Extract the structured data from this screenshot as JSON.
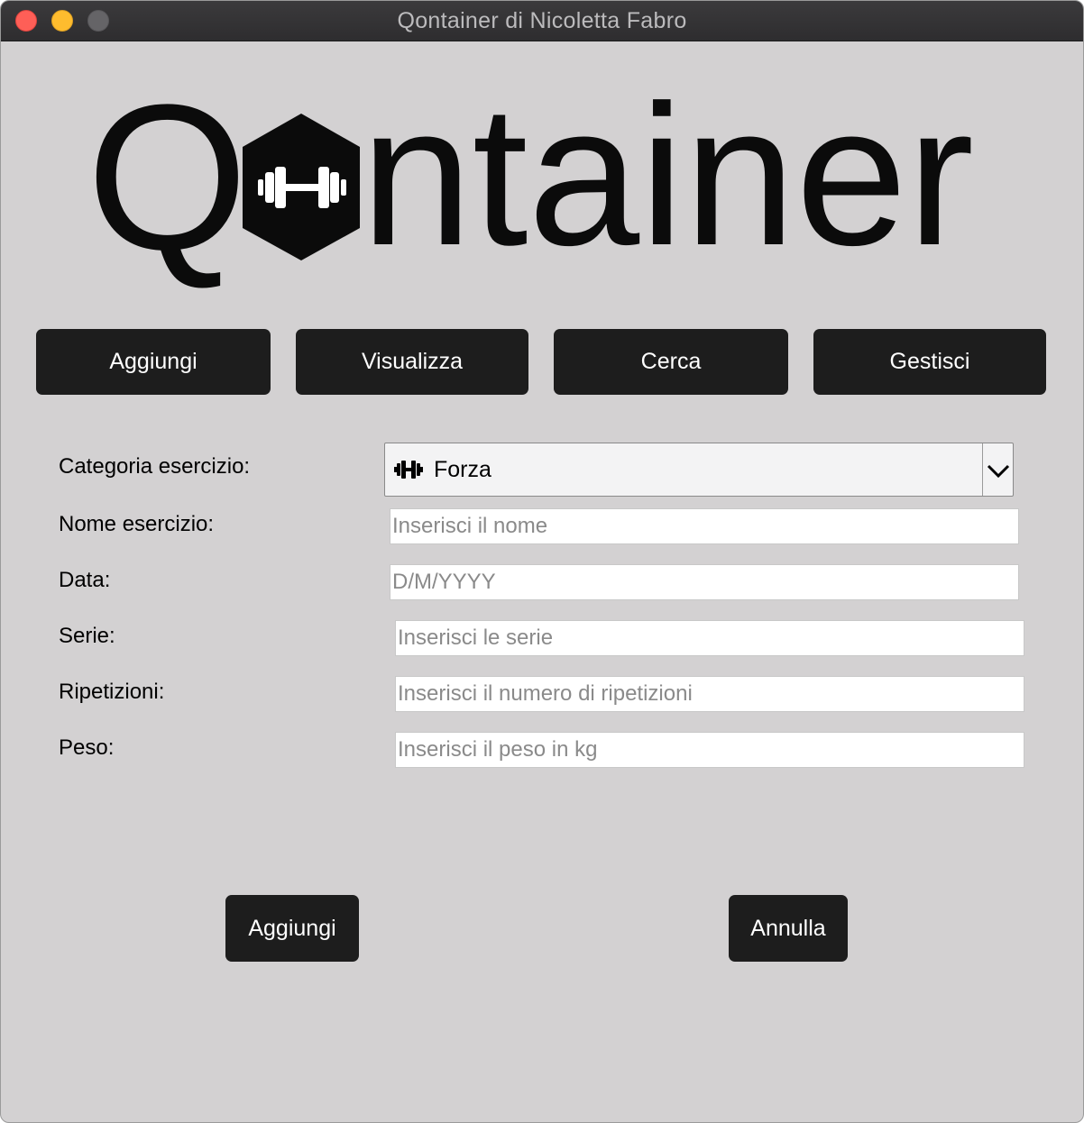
{
  "window": {
    "title": "Qontainer di Nicoletta Fabro"
  },
  "logo": {
    "text_before": "Q",
    "text_after": "ntainer",
    "icon": "dumbbell-hexagon-icon"
  },
  "nav": {
    "items": [
      {
        "label": "Aggiungi"
      },
      {
        "label": "Visualizza"
      },
      {
        "label": "Cerca"
      },
      {
        "label": "Gestisci"
      }
    ]
  },
  "form": {
    "category": {
      "label": "Categoria esercizio:",
      "value": "Forza",
      "icon": "dumbbell-icon"
    },
    "name": {
      "label": "Nome esercizio:",
      "placeholder": "Inserisci il nome",
      "value": ""
    },
    "date": {
      "label": "Data:",
      "placeholder": "D/M/YYYY",
      "value": ""
    },
    "sets": {
      "label": "Serie:",
      "placeholder": "Inserisci le serie",
      "value": ""
    },
    "reps": {
      "label": "Ripetizioni:",
      "placeholder": "Inserisci il numero di ripetizioni",
      "value": ""
    },
    "weight": {
      "label": "Peso:",
      "placeholder": "Inserisci il peso in kg",
      "value": ""
    }
  },
  "actions": {
    "add_label": "Aggiungi",
    "cancel_label": "Annulla"
  },
  "colors": {
    "background": "#d3d1d2",
    "button": "#1d1d1d",
    "button_text": "#ffffff",
    "titlebar": "#2e2d2f"
  }
}
